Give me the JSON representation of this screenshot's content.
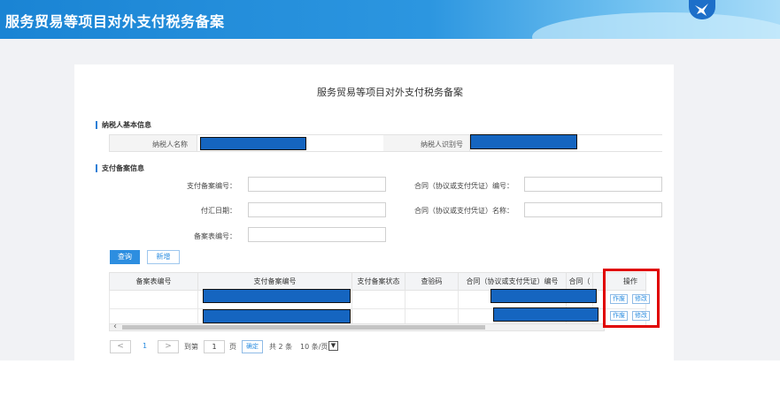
{
  "header": {
    "title": "服务贸易等项目对外支付税务备案"
  },
  "page": {
    "heading": "服务贸易等项目对外支付税务备案"
  },
  "taxpayer_section": {
    "title": "纳税人基本信息",
    "name_label": "纳税人名称",
    "id_label": "纳税人识别号"
  },
  "payment_section": {
    "title": "支付备案信息",
    "fields": {
      "filing_no": "支付备案编号：",
      "contract_no": "合同（协议或支付凭证）编号：",
      "remit_date": "付汇日期：",
      "contract_name": "合同（协议或支付凭证）名称：",
      "form_no": "备案表编号："
    }
  },
  "buttons": {
    "query": "查询",
    "add": "新增"
  },
  "table": {
    "headers": [
      "备案表编号",
      "支付备案编号",
      "支付备案状态",
      "查验码",
      "合同（协议或支付凭证）编号",
      "合同（",
      "操作"
    ],
    "row_actions": {
      "void": "作废",
      "modify": "修改"
    }
  },
  "pager": {
    "prev": "<",
    "current_page": "1",
    "next": ">",
    "goto_label": "到第",
    "page_input": "1",
    "page_unit": "页",
    "confirm": "确定",
    "total": "共 2 条",
    "page_size": "10 条/页"
  },
  "colors": {
    "accent": "#2d8ee0",
    "header_bg": "#1a84d4",
    "highlight_box": "#e00000",
    "redaction": "#1565c0"
  }
}
